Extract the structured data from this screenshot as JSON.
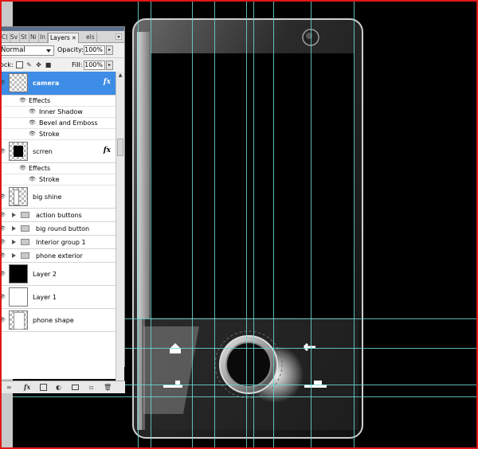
{
  "tabs": [
    "C(",
    "Sv",
    "St",
    "Ni",
    "In",
    "Layers",
    "els"
  ],
  "active_tab": "Layers",
  "blend_mode": "Normal",
  "opacity_label": "Opacity:",
  "opacity_value": "100%",
  "lock_label": "ock:",
  "fill_label": "Fill:",
  "fill_value": "100%",
  "effects_label": "Effects",
  "layers": {
    "camera": "camera",
    "camera_fx": [
      "Inner Shadow",
      "Bevel and Emboss",
      "Stroke"
    ],
    "scrren": "scrren",
    "scrren_fx": [
      "Stroke"
    ],
    "big_shine": "big shine",
    "groups": [
      "action buttons",
      "big round button",
      "Interior group 1",
      "phone exterior"
    ],
    "layer2": "Layer 2",
    "layer1": "Layer 1",
    "phone_shape": "phone shape"
  },
  "fx_badge": "fx",
  "footer": {
    "link": "∞",
    "fx": "fx",
    "new_layer": "▫",
    "delete": "🗑"
  },
  "colors": {
    "selection": "#3d8ce6",
    "guides": "#6fd6d6",
    "frame": "#e01818"
  }
}
